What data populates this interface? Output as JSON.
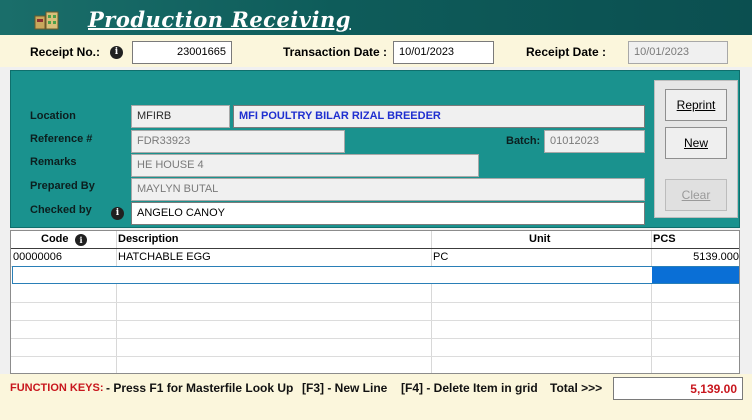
{
  "app": {
    "title": "Production Receiving",
    "icon": "warehouse-goods-icon"
  },
  "header": {
    "receipt_no_label": "Receipt No.:",
    "receipt_no": "23001665",
    "transaction_date_label": "Transaction Date :",
    "transaction_date": "10/01/2023",
    "receipt_date_label": "Receipt Date :",
    "receipt_date": "10/01/2023"
  },
  "form": {
    "location_label": "Location",
    "location_code": "MFIRB",
    "location_name": "MFI POULTRY BILAR RIZAL BREEDER",
    "reference_label": "Reference #",
    "reference": "FDR33923",
    "batch_label": "Batch:",
    "batch": "01012023",
    "remarks_label": "Remarks",
    "remarks": "HE HOUSE 4",
    "prepared_by_label": "Prepared By",
    "prepared_by": "MAYLYN BUTAL",
    "checked_by_label": "Checked by",
    "checked_by": "ANGELO CANOY"
  },
  "buttons": {
    "reprint": "Reprint",
    "new": "New",
    "clear": "Clear"
  },
  "grid": {
    "columns": [
      "Code",
      "Description",
      "Unit",
      "PCS"
    ],
    "rows": [
      {
        "code": "00000006",
        "description": "HATCHABLE EGG",
        "unit": "PC",
        "pcs": "5139.000"
      }
    ]
  },
  "footer": {
    "function_keys_label": "FUNCTION KEYS:",
    "f1_text": "- Press F1 for Masterfile Look Up",
    "f3_text": "[F3] - New Line",
    "f4_text": "[F4] - Delete Item in grid",
    "total_label": "Total >>>",
    "total_value": "5,139.00"
  },
  "colors": {
    "title_bar": "#0e5c5a",
    "panel": "#1a928e",
    "header_strip": "#fbf6dc",
    "location_name_text": "#1f2fd0",
    "function_keys_text": "#c8161d",
    "total_text": "#c8161d",
    "selected_cell": "#0a6fd6"
  }
}
